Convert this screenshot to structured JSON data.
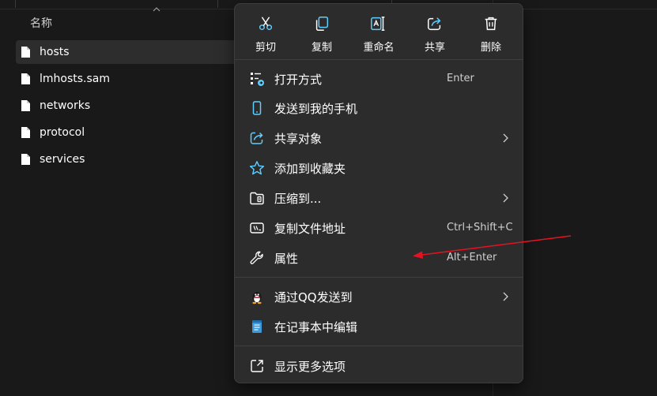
{
  "file_list": {
    "column_header": "名称",
    "files": [
      {
        "name": "hosts",
        "selected": true
      },
      {
        "name": "lmhosts.sam",
        "selected": false
      },
      {
        "name": "networks",
        "selected": false
      },
      {
        "name": "protocol",
        "selected": false
      },
      {
        "name": "services",
        "selected": false
      }
    ]
  },
  "context_menu": {
    "quick_actions": [
      {
        "id": "cut",
        "label": "剪切",
        "icon": "scissors-icon"
      },
      {
        "id": "copy",
        "label": "复制",
        "icon": "copy-icon"
      },
      {
        "id": "rename",
        "label": "重命名",
        "icon": "rename-icon"
      },
      {
        "id": "share",
        "label": "共享",
        "icon": "share-icon"
      },
      {
        "id": "delete",
        "label": "删除",
        "icon": "trash-icon"
      }
    ],
    "items": [
      {
        "id": "open-with",
        "label": "打开方式",
        "shortcut": "Enter",
        "icon": "open-with-icon"
      },
      {
        "id": "send-to-phone",
        "label": "发送到我的手机",
        "icon": "phone-icon"
      },
      {
        "id": "share-with",
        "label": "共享对象",
        "icon": "share-icon",
        "submenu": true
      },
      {
        "id": "add-favorites",
        "label": "添加到收藏夹",
        "icon": "star-icon"
      },
      {
        "id": "compress-to",
        "label": "压缩到...",
        "icon": "zip-folder-icon",
        "submenu": true
      },
      {
        "id": "copy-path",
        "label": "复制文件地址",
        "shortcut": "Ctrl+Shift+C",
        "icon": "path-icon"
      },
      {
        "id": "properties",
        "label": "属性",
        "shortcut": "Alt+Enter",
        "icon": "wrench-icon"
      },
      {
        "id": "send-via-qq",
        "label": "通过QQ发送到",
        "icon": "qq-icon",
        "submenu": true
      },
      {
        "id": "edit-notepad",
        "label": "在记事本中编辑",
        "icon": "notepad-icon"
      },
      {
        "id": "more-options",
        "label": "显示更多选项",
        "icon": "more-options-icon"
      }
    ]
  },
  "colors": {
    "background": "#191919",
    "menu_bg": "#2c2c2c",
    "selected_row": "#2d2d2d",
    "accent_blue": "#60cdff",
    "annotation_arrow": "#e81123"
  }
}
